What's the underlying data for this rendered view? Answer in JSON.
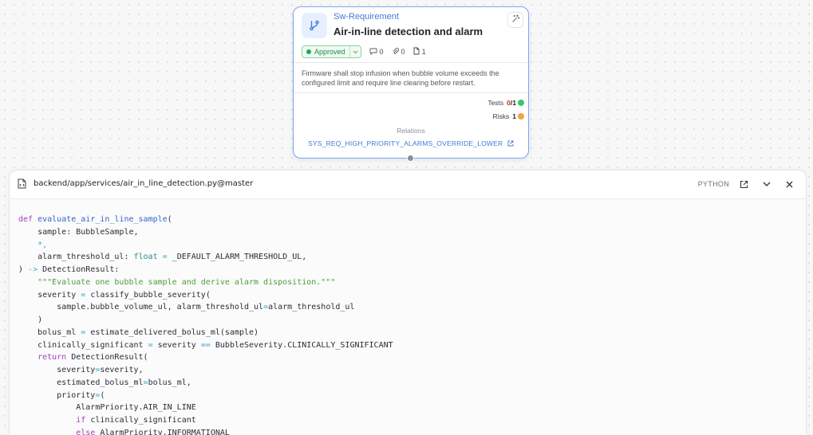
{
  "node": {
    "type_label": "Sw-Requirement",
    "title": "Air-in-line detection and alarm",
    "status": "Approved",
    "comments_count": "0",
    "attachments_count": "0",
    "documents_count": "1",
    "description": "Firmware shall stop infusion when bubble volume exceeds the configured limit and require line clearing before restart.",
    "tests_label": "Tests",
    "tests_passed": "0",
    "tests_total": "/1",
    "risks_label": "Risks",
    "risks_count": "1",
    "relations_label": "Relations",
    "relation_link": "SYS_REQ_HIGH_PRIORITY_ALARMS_OVERRIDE_LOWER",
    "icons": [
      "branch-icon",
      "sparkle-icon",
      "comment-icon",
      "paperclip-icon",
      "document-icon",
      "external-link-icon"
    ],
    "colors": {
      "accent": "#3f7bd8",
      "approved": "#1fa84f",
      "tests_dot": "#3cc46e",
      "risks_dot": "#f0a43a"
    }
  },
  "code_viewer": {
    "file_path": "backend/app/services/air_in_line_detection.py@master",
    "language": "PYTHON",
    "icons": [
      "file-code-icon",
      "external-link-icon",
      "chevron-down-icon",
      "close-icon"
    ],
    "lines": [
      [
        [
          "kw",
          "def "
        ],
        [
          "fn",
          "evaluate_air_in_line_sample"
        ],
        [
          "plain",
          "("
        ]
      ],
      [
        [
          "plain",
          "    sample: BubbleSample,"
        ]
      ],
      [
        [
          "op",
          "    *,"
        ]
      ],
      [
        [
          "plain",
          "    alarm_threshold_ul: "
        ],
        [
          "type",
          "float"
        ],
        [
          "plain",
          " "
        ],
        [
          "op",
          "="
        ],
        [
          "plain",
          " _DEFAULT_ALARM_THRESHOLD_UL,"
        ]
      ],
      [
        [
          "plain",
          ") "
        ],
        [
          "op",
          "->"
        ],
        [
          "plain",
          " DetectionResult:"
        ]
      ],
      [
        [
          "str",
          "    \"\"\"Evaluate one bubble sample and derive alarm disposition.\"\"\""
        ]
      ],
      [
        [
          "plain",
          "    severity "
        ],
        [
          "op",
          "="
        ],
        [
          "plain",
          " classify_bubble_severity("
        ]
      ],
      [
        [
          "plain",
          "        sample.bubble_volume_ul, alarm_threshold_ul"
        ],
        [
          "op",
          "="
        ],
        [
          "plain",
          "alarm_threshold_ul"
        ]
      ],
      [
        [
          "plain",
          "    )"
        ]
      ],
      [
        [
          "plain",
          "    bolus_ml "
        ],
        [
          "op",
          "="
        ],
        [
          "plain",
          " estimate_delivered_bolus_ml(sample)"
        ]
      ],
      [
        [
          "plain",
          "    clinically_significant "
        ],
        [
          "op",
          "="
        ],
        [
          "plain",
          " severity "
        ],
        [
          "op",
          "=="
        ],
        [
          "plain",
          " BubbleSeverity.CLINICALLY_SIGNIFICANT"
        ]
      ],
      [
        [
          "kw",
          "    return"
        ],
        [
          "plain",
          " DetectionResult("
        ]
      ],
      [
        [
          "plain",
          "        severity"
        ],
        [
          "op",
          "="
        ],
        [
          "plain",
          "severity,"
        ]
      ],
      [
        [
          "plain",
          "        estimated_bolus_ml"
        ],
        [
          "op",
          "="
        ],
        [
          "plain",
          "bolus_ml,"
        ]
      ],
      [
        [
          "plain",
          "        priority"
        ],
        [
          "op",
          "="
        ],
        [
          "plain",
          "("
        ]
      ],
      [
        [
          "plain",
          "            AlarmPriority.AIR_IN_LINE"
        ]
      ],
      [
        [
          "kw",
          "            if"
        ],
        [
          "plain",
          " clinically_significant"
        ]
      ],
      [
        [
          "kw",
          "            else"
        ],
        [
          "plain",
          " AlarmPriority.INFORMATIONAL"
        ]
      ]
    ]
  }
}
